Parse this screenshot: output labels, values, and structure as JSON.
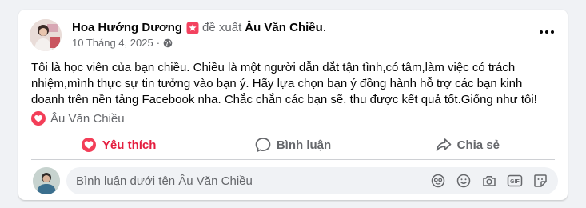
{
  "post": {
    "author": "Hoa Hướng Dương",
    "recommend_text": "đề xuất",
    "target": "Âu Văn Chiều",
    "target_suffix": ".",
    "date": "10 Tháng 4, 2025",
    "meta_separator": "·",
    "body": "Tôi là học viên của bạn chiều. Chiều là một người dẫn dắt tận tình,có tâm,làm việc có trách nhiệm,mình thực sự tin tưởng vào bạn ý. Hãy lựa chọn bạn ý đồng hành hỗ trợ các bạn kinh doanh trên nền tảng Facebook nha. Chắc chắn các bạn sẽ. thu được kết quả tốt.Giống như tôi!",
    "reaction_name": "Âu Văn Chiều"
  },
  "actions": {
    "like": "Yêu thích",
    "comment": "Bình luận",
    "share": "Chia sẻ"
  },
  "comment_box": {
    "placeholder": "Bình luận dưới tên Âu Văn Chiều"
  },
  "icons": {
    "recommend": "recommend-badge-icon",
    "privacy": "globe-icon",
    "more": "more-options-icon",
    "reaction": "heart-reaction-icon",
    "like": "heart-icon",
    "comment": "speech-bubble-icon",
    "share": "share-arrow-icon",
    "comment_tools": [
      "avatar-sticker-icon",
      "emoji-icon",
      "camera-icon",
      "gif-icon",
      "sticker-icon"
    ]
  },
  "colors": {
    "liked": "#e41e3f",
    "recommend_badge": "#f3425f",
    "secondary_text": "#65676b"
  }
}
